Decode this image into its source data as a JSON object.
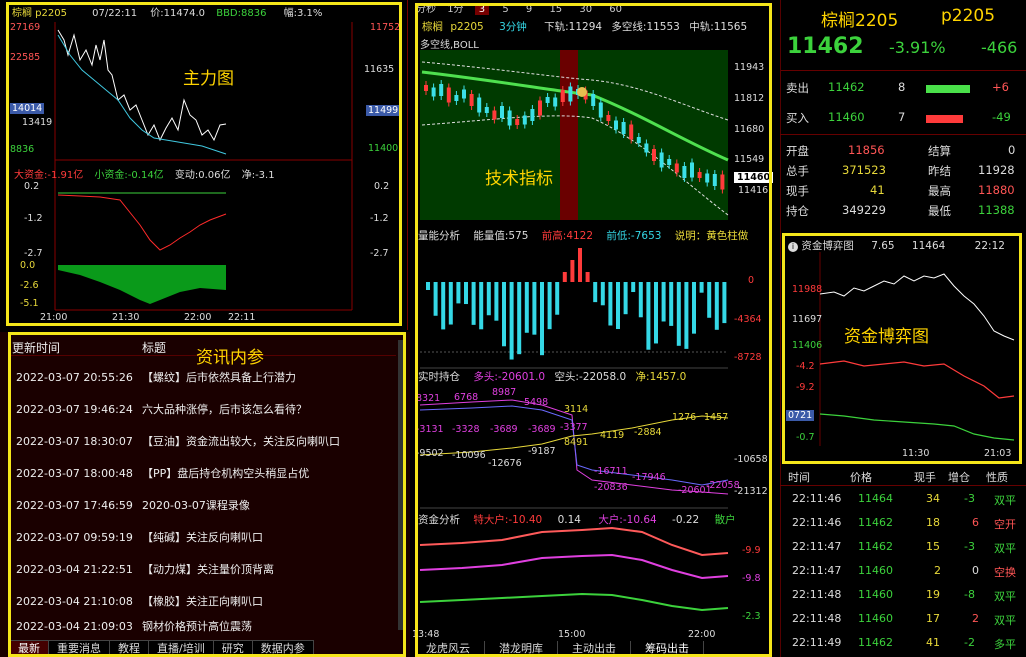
{
  "colors": {
    "accent_yellow": "#f5e61a",
    "up": "#ff3b3b",
    "down": "#3cd23c",
    "panel_bg": "#000000",
    "news_bg": "#1a0000"
  },
  "main_chart": {
    "header": {
      "symbol": "棕榈 p2205",
      "time": "07/22:11",
      "price": "价:11474.0",
      "bbd": "BBD:8836",
      "amp": "幅:3.1%"
    },
    "overlay_label": "主力图",
    "left_axis": [
      "27169",
      "22585",
      "14014",
      "13419",
      "8836"
    ],
    "right_axis": [
      "11752",
      "11635",
      "11499",
      "11400"
    ],
    "cash_header": {
      "big": "大资金:-1.91亿",
      "small": "小资金:-0.14亿",
      "change": "变动:0.06亿",
      "net": "净:-3.1"
    },
    "cash_left_axis": [
      "0.2",
      "-1.2",
      "-2.7",
      "0.0",
      "-2.6",
      "-5.1"
    ],
    "cash_right_axis": [
      "0.2",
      "-1.2",
      "-2.7"
    ],
    "time_axis": [
      "21:00",
      "21:30",
      "22:00",
      "22:11"
    ]
  },
  "news": {
    "overlay_label": "资讯内参",
    "col_time": "更新时间",
    "col_title": "标题",
    "rows": [
      {
        "time": "2022-03-07 20:55:26",
        "title": "【螺纹】后市依然具备上行潜力"
      },
      {
        "time": "2022-03-07 19:46:24",
        "title": "六大品种涨停，后市该怎么看待？"
      },
      {
        "time": "2022-03-07 18:30:07",
        "title": "【豆油】资金流出较大，关注反向喇叭口"
      },
      {
        "time": "2022-03-07 18:00:48",
        "title": "【PP】盘后持仓机构空头稍显占优"
      },
      {
        "time": "2022-03-07 17:46:59",
        "title": "2020-03-07课程录像"
      },
      {
        "time": "2022-03-07 09:59:19",
        "title": "【纯碱】关注反向喇叭口"
      },
      {
        "time": "2022-03-04 21:22:51",
        "title": "【动力煤】关注量价顶背离"
      },
      {
        "time": "2022-03-04 21:10:08",
        "title": "【橡胶】关注正向喇叭口"
      },
      {
        "time": "2022-03-04 21:09:03",
        "title": "钢材价格预计高位震荡"
      }
    ],
    "tabs": [
      "最新",
      "重要消息",
      "教程",
      "直播/培训",
      "研究",
      "数据内参"
    ]
  },
  "tech": {
    "period_tabs": [
      "分秒",
      "1分",
      "3",
      "5",
      "9",
      "15",
      "30",
      "60"
    ],
    "header": {
      "symbol": "棕榈",
      "code": "p2205",
      "period": "3分钟",
      "lower": "下轨:11294",
      "mid_long_short": "多空线:11553",
      "mid": "中轨:11565"
    },
    "indicator": "多空线,BOLL",
    "overlay_label": "技术指标",
    "price_axis": [
      "11943",
      "11812",
      "11680",
      "11549",
      "11416"
    ],
    "last_price_tag": "11460",
    "energy": {
      "title": "量能分析",
      "value": "能量值:575",
      "high": "前高:4122",
      "low": "前低:-7653",
      "note": "说明：黄色柱做"
    },
    "energy_axis": [
      "0",
      "-4364",
      "-8728"
    ],
    "oi": {
      "title": "实时持仓",
      "long": "多头:-20601.0",
      "short": "空头:-22058.0",
      "net": "净:1457.0"
    },
    "oi_labels": [
      "8321",
      "6768",
      "8987",
      "5498",
      "3114",
      "1276",
      "1457",
      "-3131",
      "-3328",
      "-3689",
      "-3689",
      "-3377",
      "4119",
      "-2884",
      "8491",
      "-9502",
      "-10096",
      "-12676",
      "-9187",
      "-16711",
      "-17946",
      "-20836",
      "-20601",
      "-22058"
    ],
    "oi_axis": [
      "-10658",
      "-21312"
    ],
    "fund": {
      "title": "资金分析",
      "big": "特大户:-10.40",
      "v1": "0.14",
      "large": "大户:-10.64",
      "v2": "-0.22",
      "retail": "散户"
    },
    "fund_axis": [
      "-9.9",
      "-9.8",
      "-2.3"
    ],
    "time_axis": [
      "13:48",
      "15:00",
      "22:00"
    ],
    "bottom_tabs": [
      "龙虎风云",
      "潜龙明库",
      "主动出击",
      "筹码出击"
    ]
  },
  "quote": {
    "name": "棕榈2205",
    "code": "p2205",
    "last": "11462",
    "pct": "-3.91%",
    "chg": "-466",
    "sell": {
      "label": "卖出",
      "price": "11462",
      "vol": "8",
      "diff": "+6",
      "bar": 0.6
    },
    "buy": {
      "label": "买入",
      "price": "11460",
      "vol": "7",
      "diff": "-49",
      "bar": 0.5
    },
    "stats": [
      {
        "k1": "开盘",
        "v1": "11856",
        "k2": "结算",
        "v2": "0"
      },
      {
        "k1": "总手",
        "v1": "371523",
        "k2": "昨结",
        "v2": "11928"
      },
      {
        "k1": "现手",
        "v1": "41",
        "k2": "最高",
        "v2": "11880"
      },
      {
        "k1": "持仓",
        "v1": "349229",
        "k2": "最低",
        "v2": "11388"
      }
    ]
  },
  "game": {
    "title": "资金博弈图",
    "v1": "7.65",
    "v2": "11464",
    "time": "22:12",
    "overlay_label": "资金博弈图",
    "left_axis": [
      "11988",
      "11697",
      "11406",
      "-4.2",
      "-9.2",
      "0721",
      "-0.7"
    ],
    "time_axis": [
      "11:30",
      "21:03"
    ]
  },
  "ticks": {
    "cols": [
      "时间",
      "价格",
      "现手",
      "增仓",
      "性质"
    ],
    "rows": [
      {
        "t": "22:11:46",
        "p": "11464",
        "v": "34",
        "d": "-3",
        "n": "双平"
      },
      {
        "t": "22:11:46",
        "p": "11462",
        "v": "18",
        "d": "6",
        "n": "空开"
      },
      {
        "t": "22:11:47",
        "p": "11462",
        "v": "15",
        "d": "-3",
        "n": "双平"
      },
      {
        "t": "22:11:47",
        "p": "11460",
        "v": "2",
        "d": "0",
        "n": "空换"
      },
      {
        "t": "22:11:48",
        "p": "11460",
        "v": "19",
        "d": "-8",
        "n": "双平"
      },
      {
        "t": "22:11:48",
        "p": "11460",
        "v": "17",
        "d": "2",
        "n": "双平"
      },
      {
        "t": "22:11:49",
        "p": "11462",
        "v": "41",
        "d": "-2",
        "n": "多平"
      }
    ]
  }
}
